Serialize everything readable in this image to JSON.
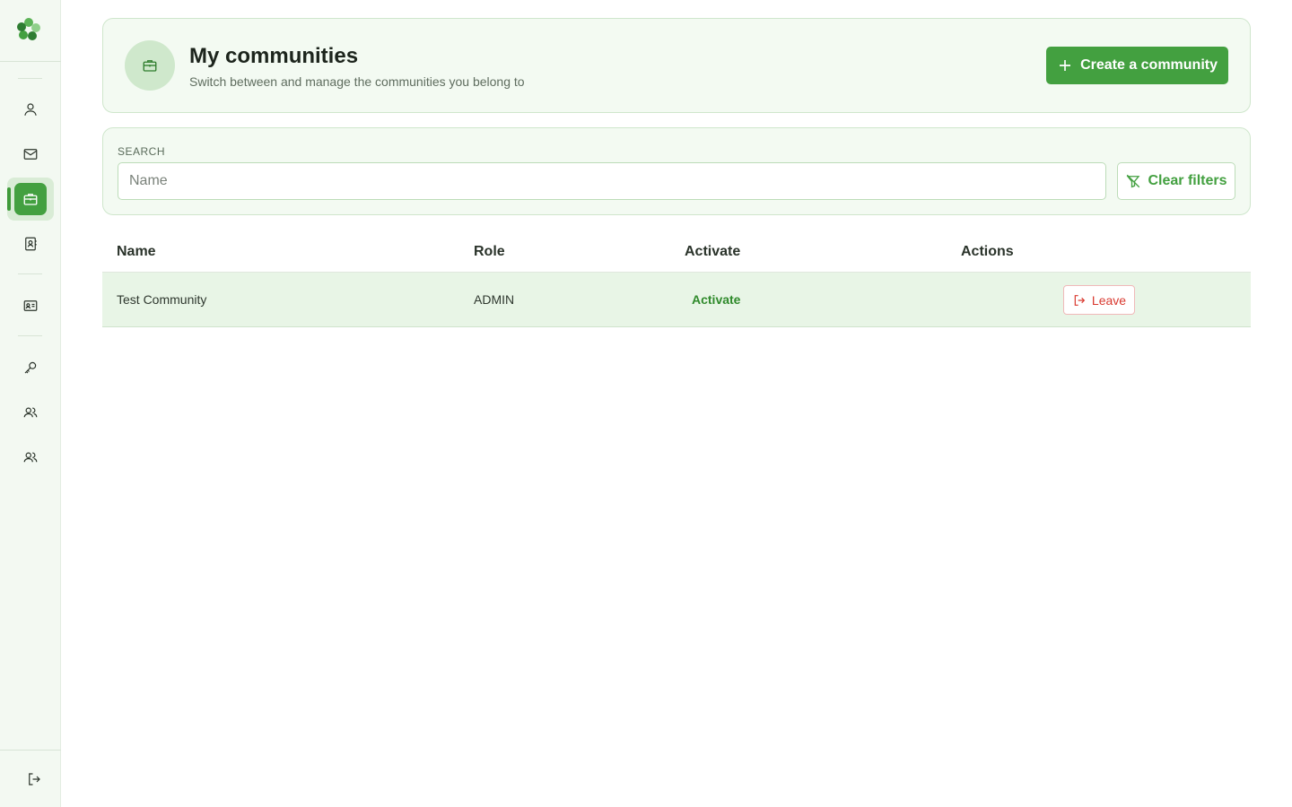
{
  "sidebar": {
    "logo": "clover-logo",
    "items": [
      {
        "icon": "user-icon",
        "active": false
      },
      {
        "icon": "mail-icon",
        "active": false
      },
      {
        "icon": "briefcase-icon",
        "active": true
      },
      {
        "icon": "contacts-book-icon",
        "active": false
      },
      {
        "icon": "id-card-icon",
        "active": false
      },
      {
        "icon": "key-icon",
        "active": false
      },
      {
        "icon": "users-icon",
        "active": false
      },
      {
        "icon": "users-icon",
        "active": false
      }
    ],
    "logout_icon": "logout-icon"
  },
  "header": {
    "icon": "briefcase-icon",
    "title": "My communities",
    "subtitle": "Switch between and manage the communities you belong to",
    "create_label": "Create a community"
  },
  "search": {
    "label": "SEARCH",
    "placeholder": "Name",
    "value": "",
    "clear_label": "Clear filters"
  },
  "table": {
    "columns": [
      "Name",
      "Role",
      "Activate",
      "Actions"
    ],
    "rows": [
      {
        "name": "Test Community",
        "role": "ADMIN",
        "activate_label": "Activate",
        "action_label": "Leave"
      }
    ]
  },
  "colors": {
    "accent": "#43a040",
    "danger": "#d9392f",
    "panel_bg": "#f3faf2"
  }
}
